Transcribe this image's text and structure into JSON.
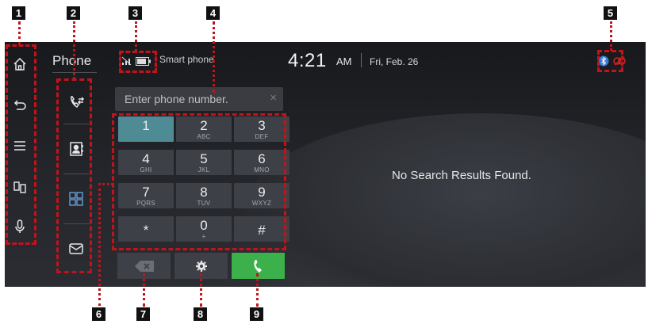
{
  "header": {
    "app_title": "Phone",
    "device_name": "Smart phone",
    "time": "4:21",
    "ampm": "AM",
    "date": "Fri, Feb. 26"
  },
  "sidebar": {
    "items": [
      {
        "name": "home"
      },
      {
        "name": "back"
      },
      {
        "name": "menu"
      },
      {
        "name": "split-screen"
      },
      {
        "name": "voice"
      }
    ]
  },
  "phone_tabs": [
    {
      "name": "recent-calls"
    },
    {
      "name": "contacts"
    },
    {
      "name": "keypad"
    },
    {
      "name": "messages"
    }
  ],
  "dial": {
    "placeholder": "Enter phone number.",
    "clear": "×"
  },
  "keypad": {
    "keys": [
      {
        "num": "1",
        "letters": ""
      },
      {
        "num": "2",
        "letters": "ABC"
      },
      {
        "num": "3",
        "letters": "DEF"
      },
      {
        "num": "4",
        "letters": "GHI"
      },
      {
        "num": "5",
        "letters": "JKL"
      },
      {
        "num": "6",
        "letters": "MNO"
      },
      {
        "num": "7",
        "letters": "PQRS"
      },
      {
        "num": "8",
        "letters": "TUV"
      },
      {
        "num": "9",
        "letters": "WXYZ"
      },
      {
        "num": "*",
        "letters": ""
      },
      {
        "num": "0",
        "letters": "+"
      },
      {
        "num": "#",
        "letters": ""
      }
    ]
  },
  "main": {
    "no_results": "No Search Results Found."
  },
  "callouts": {
    "c1": "1",
    "c2": "2",
    "c3": "3",
    "c4": "4",
    "c5": "5",
    "c6": "6",
    "c7": "7",
    "c8": "8",
    "c9": "9"
  },
  "colors": {
    "call_button": "#3cb04a",
    "active_key": "#4f8b95",
    "annotation": "#c0141c"
  }
}
